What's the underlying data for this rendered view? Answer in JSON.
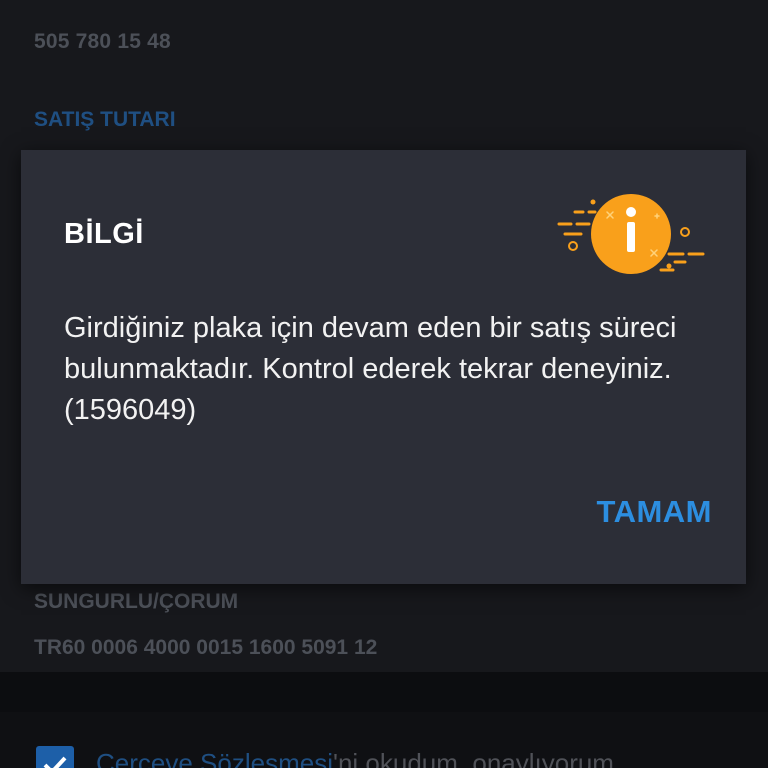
{
  "background": {
    "phone": "505 780 15 48",
    "sales_label": "SATIŞ TUTARI",
    "city": "SUNGURLU/ÇORUM",
    "iban": "TR60 0006 4000 0015 1600 5091 12",
    "agreement": {
      "link_text": "Çerçeve Sözleşmesi",
      "rest_text": "'ni okudum, onaylıyorum",
      "checked": true
    }
  },
  "dialog": {
    "title": "BİLGİ",
    "icon": "info-icon",
    "message": "Girdiğiniz plaka için devam eden bir satış süreci bulunmaktadır. Kontrol ederek tekrar deneyiniz.(1596049)",
    "ok_label": "TAMAM"
  },
  "colors": {
    "dialog_bg": "#2c2e37",
    "accent": "#2c8ee0",
    "info_orange": "#f9a01b",
    "link_blue": "#1f4f82"
  }
}
